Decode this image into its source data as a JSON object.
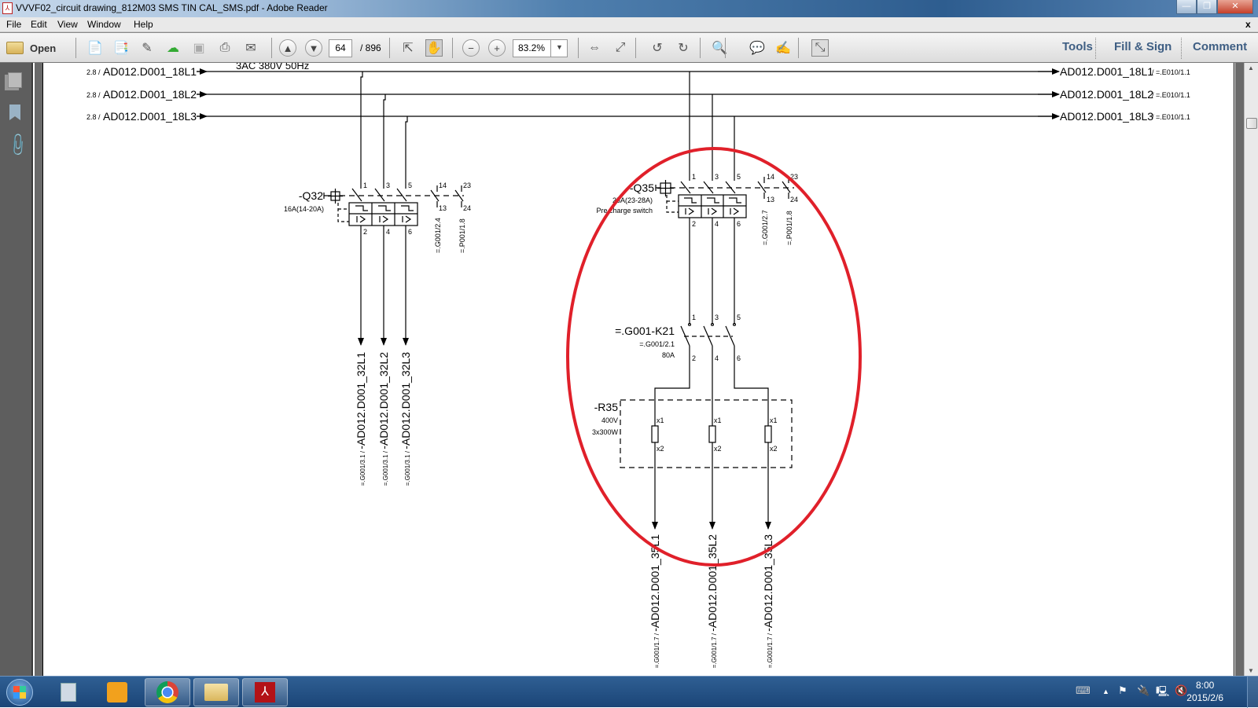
{
  "window": {
    "title": "VVVF02_circuit drawing_812M03 SMS TIN CAL_SMS.pdf - Adobe Reader",
    "doc_close": "x"
  },
  "menu": [
    "File",
    "Edit",
    "View",
    "Window",
    "Help"
  ],
  "toolbar": {
    "open_label": "Open",
    "page_current": "64",
    "page_total": "/ 896",
    "zoom": "83.2%",
    "tools": "Tools",
    "fill_sign": "Fill & Sign",
    "comment": "Comment"
  },
  "diagram": {
    "supply": "3AC 380V 50Hz",
    "bus_in": [
      {
        "ref": "2.8 /",
        "label": "AD012.D001_18L1"
      },
      {
        "ref": "2.8 /",
        "label": "AD012.D001_18L2"
      },
      {
        "ref": "2.8 /",
        "label": "AD012.D001_18L3"
      }
    ],
    "bus_out": [
      {
        "label": "AD012.D001_18L1",
        "ref": "/ =.E010/1.1"
      },
      {
        "label": "AD012.D001_18L2",
        "ref": "/ =.E010/1.1"
      },
      {
        "label": "AD012.D001_18L3",
        "ref": "/ =.E010/1.1"
      }
    ],
    "q32": {
      "name": "-Q32",
      "rating": "16A(14-20A)",
      "top": [
        "1",
        "3",
        "5"
      ],
      "bottom": [
        "2",
        "4",
        "6"
      ],
      "aux": [
        "14",
        "13",
        "23",
        "24"
      ],
      "aux_refs": [
        "=.G001/2.4",
        "=.P001/1.8"
      ],
      "outputs": [
        {
          "ref": "=.G001/3.1 / ",
          "label": "-AD012.D001_32L1"
        },
        {
          "ref": "=.G001/3.1 / ",
          "label": "-AD012.D001_32L2"
        },
        {
          "ref": "=.G001/3.1 / ",
          "label": "-AD012.D001_32L3"
        }
      ]
    },
    "q35": {
      "name": "-Q35",
      "rating": "25A(23-28A)",
      "desc": "Pre charge switch",
      "top": [
        "1",
        "3",
        "5"
      ],
      "bottom": [
        "2",
        "4",
        "6"
      ],
      "aux": [
        "14",
        "13",
        "23",
        "24"
      ],
      "aux_refs": [
        "=.G001/2.7",
        "=.P001/1.8"
      ]
    },
    "k21": {
      "name": "=.G001-K21",
      "ref": "=.G001/2.1",
      "rating": "80A",
      "top": [
        "1",
        "3",
        "5"
      ],
      "bottom": [
        "2",
        "4",
        "6"
      ]
    },
    "r35": {
      "name": "-R35",
      "voltage": "400V",
      "power": "3x300W",
      "x1": "x1",
      "x2": "x2",
      "outputs": [
        {
          "ref": "=.G001/1.7 / ",
          "label": "-AD012.D001_35L1"
        },
        {
          "ref": "=.G001/1.7 / ",
          "label": "-AD012.D001_35L2"
        },
        {
          "ref": "=.G001/1.7 / ",
          "label": "-AD012.D001_35L3"
        }
      ]
    },
    "highlight_color": "#e0202a"
  },
  "taskbar": {
    "time": "8:00",
    "date": "2015/2/6"
  }
}
